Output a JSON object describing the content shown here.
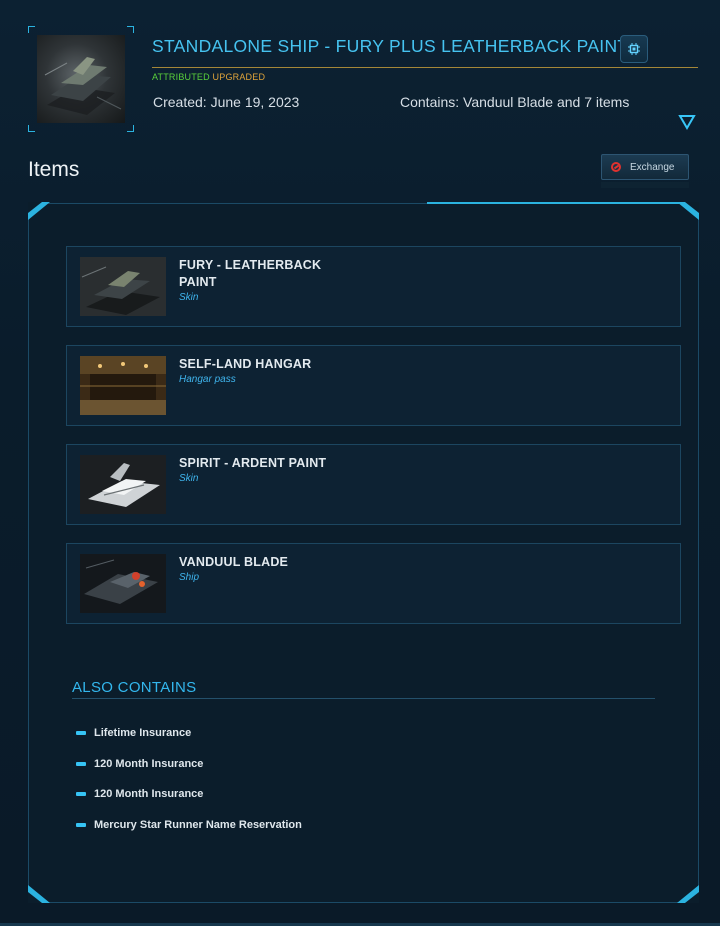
{
  "pledge": {
    "title": "STANDALONE SHIP - FURY PLUS LEATHERBACK PAINT",
    "tags": {
      "attributed": "ATTRIBUTED",
      "upgraded": "UPGRADED"
    },
    "created": "Created: June 19, 2023",
    "contains": "Contains: Vanduul Blade and 7 items",
    "chip_icon": "microchip-icon",
    "expand_icon": "triangle-down-icon"
  },
  "items_section": {
    "heading": "Items",
    "exchange_label": "Exchange",
    "exchange_icon": "prohibited-icon"
  },
  "items": [
    {
      "name": "FURY - LEATHERBACK PAINT",
      "type": "Skin"
    },
    {
      "name": "SELF-LAND HANGAR",
      "type": "Hangar pass"
    },
    {
      "name": "SPIRIT - ARDENT PAINT",
      "type": "Skin"
    },
    {
      "name": "VANDUUL BLADE",
      "type": "Ship"
    }
  ],
  "also_contains": {
    "title": "ALSO CONTAINS",
    "items": [
      "Lifetime Insurance",
      "120 Month Insurance",
      "120 Month Insurance",
      "Mercury Star Runner Name Reservation"
    ]
  },
  "colors": {
    "accent": "#46c3f0",
    "attributed": "#5ad13a",
    "upgraded": "#e0a43a",
    "title_rule": "#c19a3a",
    "danger": "#e0322f"
  }
}
